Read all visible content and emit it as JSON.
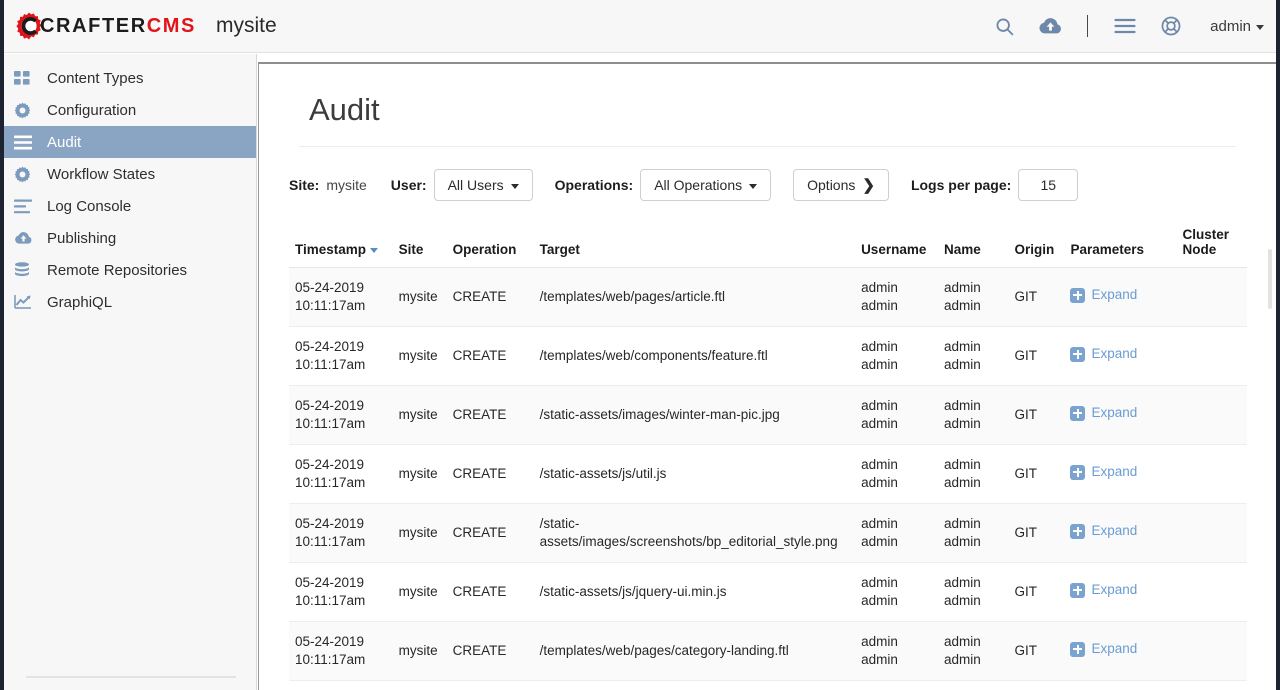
{
  "header": {
    "brand_crafter": "CRAFTER",
    "brand_cms": "CMS",
    "site_name": "mysite",
    "icons": [
      {
        "name": "search-icon",
        "label": "Search"
      },
      {
        "name": "cloud-upload-icon",
        "label": "Publish"
      },
      {
        "name": "hamburger-menu-icon",
        "label": "Menu"
      },
      {
        "name": "help-lifebuoy-icon",
        "label": "Help"
      }
    ],
    "user_menu": "admin"
  },
  "sidebar": {
    "items": [
      {
        "label": "Content Types",
        "icon": "grid-icon",
        "active": false
      },
      {
        "label": "Configuration",
        "icon": "gear-icon",
        "active": false
      },
      {
        "label": "Audit",
        "icon": "list-bars-icon",
        "active": true
      },
      {
        "label": "Workflow States",
        "icon": "gear-icon",
        "active": false
      },
      {
        "label": "Log Console",
        "icon": "align-left-icon",
        "active": false
      },
      {
        "label": "Publishing",
        "icon": "cloud-upload-icon",
        "active": false
      },
      {
        "label": "Remote Repositories",
        "icon": "database-icon",
        "active": false
      },
      {
        "label": "GraphiQL",
        "icon": "chart-line-icon",
        "active": false
      }
    ]
  },
  "main": {
    "title": "Audit",
    "filters": {
      "site_label": "Site:",
      "site_value": "mysite",
      "user_label": "User:",
      "user_value": "All Users",
      "operations_label": "Operations:",
      "operations_value": "All Operations",
      "options_button": "Options",
      "logs_per_page_label": "Logs per page:",
      "logs_per_page_value": "15"
    },
    "table": {
      "columns": [
        {
          "key": "timestamp",
          "label": "Timestamp",
          "sortable": true,
          "sort_dir": "desc"
        },
        {
          "key": "site",
          "label": "Site",
          "sortable": false
        },
        {
          "key": "operation",
          "label": "Operation",
          "sortable": false
        },
        {
          "key": "target",
          "label": "Target",
          "sortable": false
        },
        {
          "key": "username",
          "label": "Username",
          "sortable": false
        },
        {
          "key": "name",
          "label": "Name",
          "sortable": false
        },
        {
          "key": "origin",
          "label": "Origin",
          "sortable": false
        },
        {
          "key": "parameters",
          "label": "Parameters",
          "sortable": false
        },
        {
          "key": "cluster",
          "label": "Cluster Node",
          "sortable": false
        }
      ],
      "expand_label": "Expand",
      "rows": [
        {
          "date": "05-24-2019",
          "time": "10:11:17am",
          "site": "mysite",
          "operation": "CREATE",
          "target": "/templates/web/pages/article.ftl",
          "username_1": "admin",
          "username_2": "admin",
          "name_1": "admin",
          "name_2": "admin",
          "origin": "GIT",
          "cluster": ""
        },
        {
          "date": "05-24-2019",
          "time": "10:11:17am",
          "site": "mysite",
          "operation": "CREATE",
          "target": "/templates/web/components/feature.ftl",
          "username_1": "admin",
          "username_2": "admin",
          "name_1": "admin",
          "name_2": "admin",
          "origin": "GIT",
          "cluster": ""
        },
        {
          "date": "05-24-2019",
          "time": "10:11:17am",
          "site": "mysite",
          "operation": "CREATE",
          "target": "/static-assets/images/winter-man-pic.jpg",
          "username_1": "admin",
          "username_2": "admin",
          "name_1": "admin",
          "name_2": "admin",
          "origin": "GIT",
          "cluster": ""
        },
        {
          "date": "05-24-2019",
          "time": "10:11:17am",
          "site": "mysite",
          "operation": "CREATE",
          "target": "/static-assets/js/util.js",
          "username_1": "admin",
          "username_2": "admin",
          "name_1": "admin",
          "name_2": "admin",
          "origin": "GIT",
          "cluster": ""
        },
        {
          "date": "05-24-2019",
          "time": "10:11:17am",
          "site": "mysite",
          "operation": "CREATE",
          "target": "/static-assets/images/screenshots/bp_editorial_style.png",
          "username_1": "admin",
          "username_2": "admin",
          "name_1": "admin",
          "name_2": "admin",
          "origin": "GIT",
          "cluster": ""
        },
        {
          "date": "05-24-2019",
          "time": "10:11:17am",
          "site": "mysite",
          "operation": "CREATE",
          "target": "/static-assets/js/jquery-ui.min.js",
          "username_1": "admin",
          "username_2": "admin",
          "name_1": "admin",
          "name_2": "admin",
          "origin": "GIT",
          "cluster": ""
        },
        {
          "date": "05-24-2019",
          "time": "10:11:17am",
          "site": "mysite",
          "operation": "CREATE",
          "target": "/templates/web/pages/category-landing.ftl",
          "username_1": "admin",
          "username_2": "admin",
          "name_1": "admin",
          "name_2": "admin",
          "origin": "GIT",
          "cluster": ""
        }
      ]
    }
  },
  "colors": {
    "brand_red": "#e0141a",
    "accent_blue": "#7d9bbd",
    "active_nav": "#8aa5c3",
    "link_blue": "#5b8cc0",
    "edge_dark": "#1d2331"
  }
}
